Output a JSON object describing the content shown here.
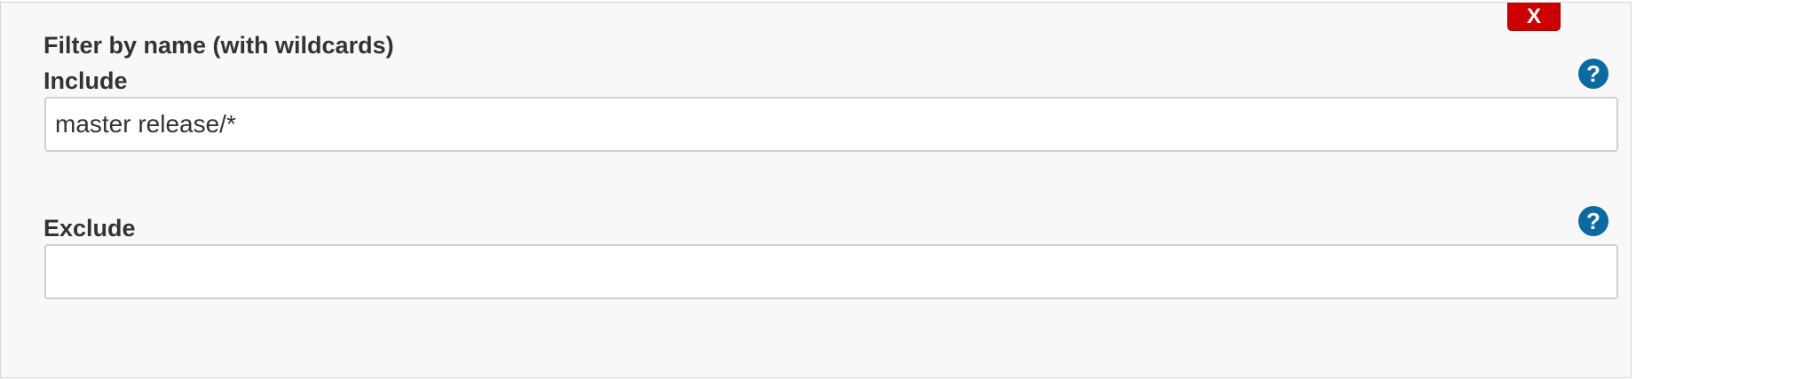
{
  "panel": {
    "title": "Filter by name (with wildcards)",
    "delete_label": "X",
    "include": {
      "label": "Include",
      "value": "master release/*",
      "help_glyph": "?"
    },
    "exclude": {
      "label": "Exclude",
      "value": "",
      "help_glyph": "?"
    }
  },
  "icons": {
    "help": "question-circle-icon"
  },
  "colors": {
    "delete_button": "#cc0000",
    "help_icon": "#0b6aa2",
    "panel_background": "#f8f8f8"
  }
}
